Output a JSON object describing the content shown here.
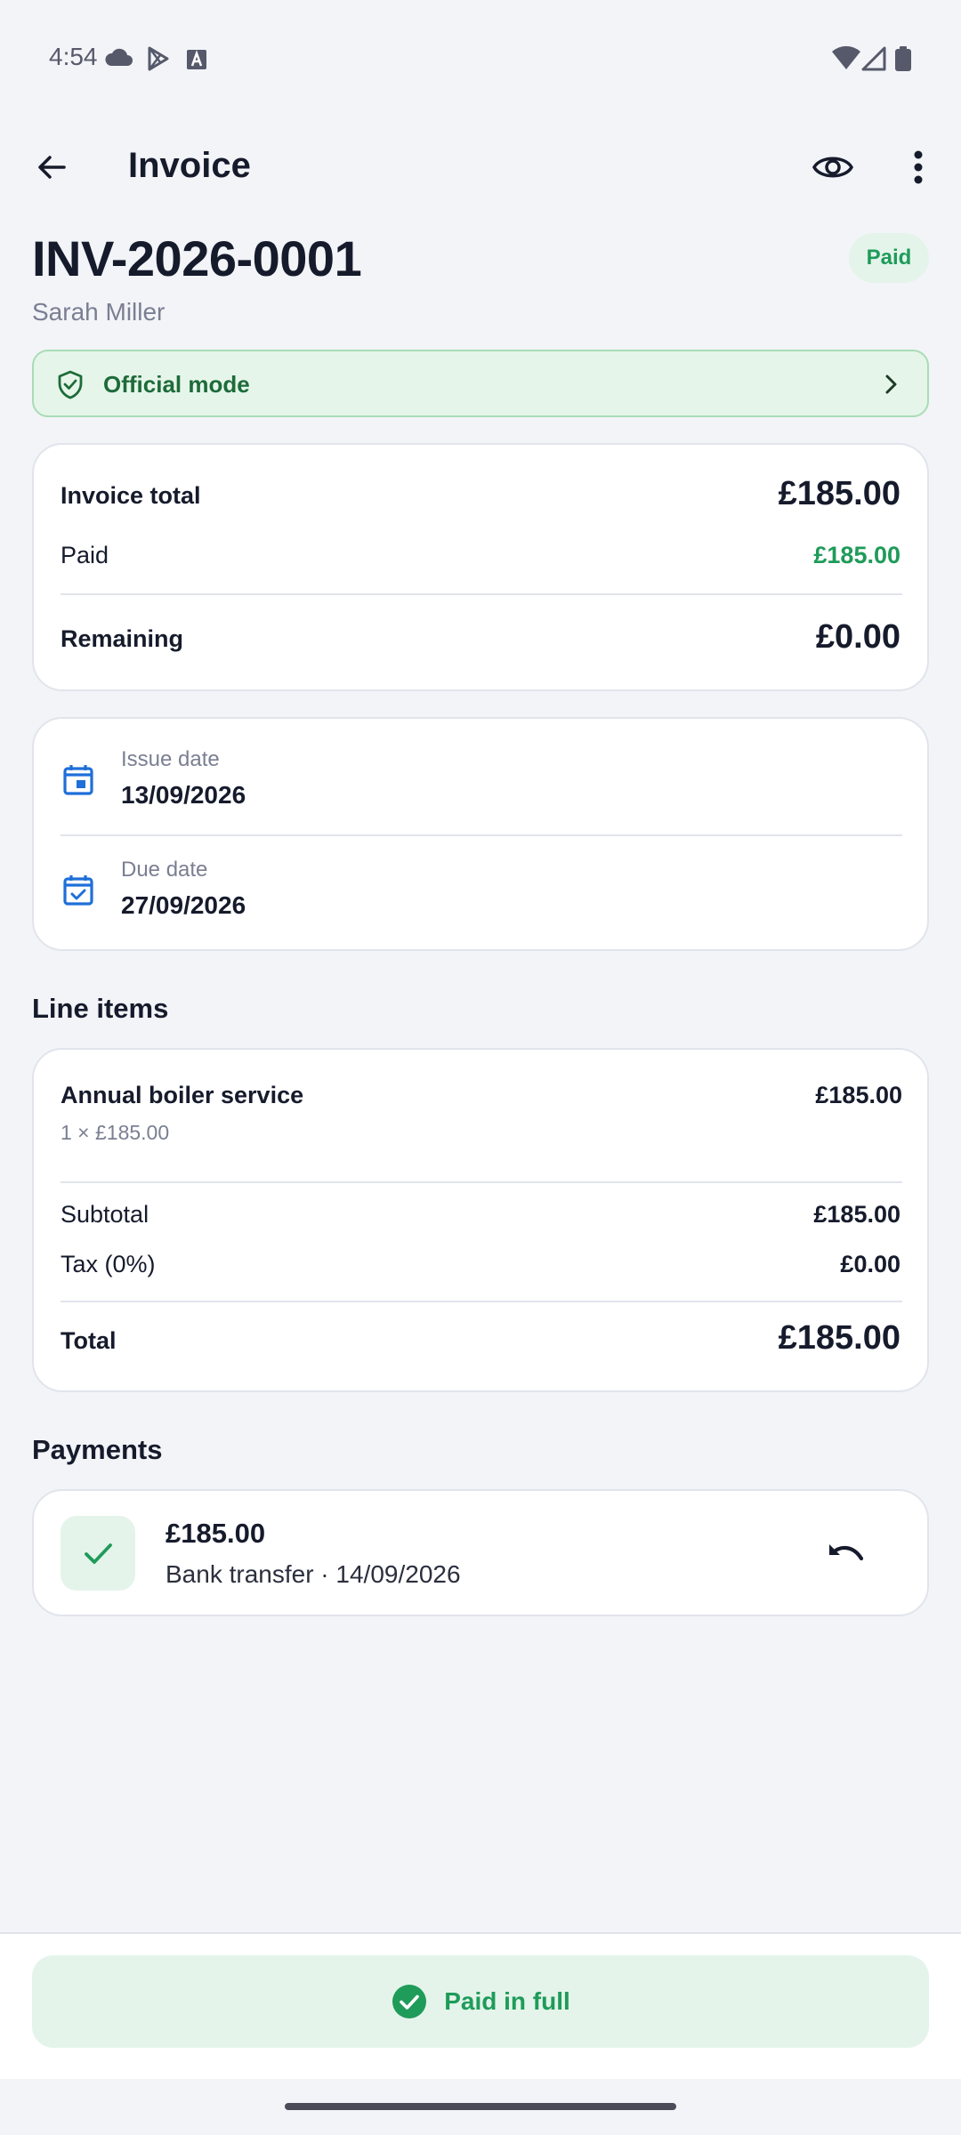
{
  "status_bar": {
    "time": "4:54"
  },
  "app_bar": {
    "title": "Invoice"
  },
  "invoice": {
    "number": "INV-2026-0001",
    "client": "Sarah Miller",
    "status": "Paid"
  },
  "mode_banner": {
    "label": "Official mode"
  },
  "totals": {
    "invoice_total_label": "Invoice total",
    "invoice_total_value": "£185.00",
    "paid_label": "Paid",
    "paid_value": "£185.00",
    "remaining_label": "Remaining",
    "remaining_value": "£0.00"
  },
  "dates": {
    "issue_label": "Issue date",
    "issue_value": "13/09/2026",
    "due_label": "Due date",
    "due_value": "27/09/2026"
  },
  "line_items": {
    "section_title": "Line items",
    "items": [
      {
        "name": "Annual boiler service",
        "detail": "1 × £185.00",
        "amount": "£185.00"
      }
    ],
    "subtotal_label": "Subtotal",
    "subtotal_value": "£185.00",
    "tax_label": "Tax (0%)",
    "tax_value": "£0.00",
    "total_label": "Total",
    "total_value": "£185.00"
  },
  "payments": {
    "section_title": "Payments",
    "items": [
      {
        "amount": "£185.00",
        "detail": "Bank transfer · 14/09/2026"
      }
    ]
  },
  "footer": {
    "paid_full_label": "Paid in full"
  },
  "colors": {
    "accent_green": "#1f9b5a",
    "badge_bg": "#e4f4ea",
    "icon_blue": "#1e6fd9",
    "background": "#f3f4f8"
  },
  "icons": [
    "back-arrow-icon",
    "eye-icon",
    "more-vert-icon",
    "shield-check-icon",
    "chevron-right-icon",
    "calendar-icon",
    "calendar-check-icon",
    "check-icon",
    "undo-icon",
    "check-circle-icon"
  ]
}
